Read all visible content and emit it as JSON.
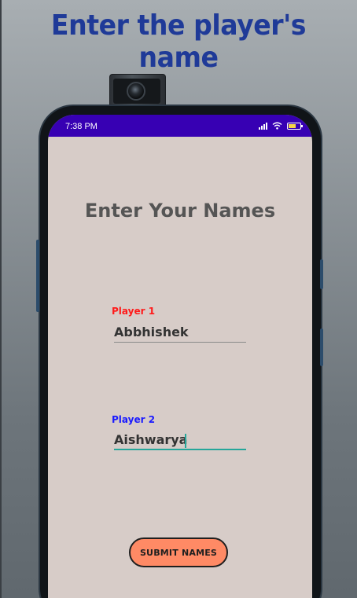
{
  "header": {
    "title": "Enter the player's name"
  },
  "status_bar": {
    "time": "7:38 PM",
    "battery_level": "80"
  },
  "app": {
    "title": "Enter Your Names",
    "player1": {
      "label": "Player 1",
      "value": "Abbhishek"
    },
    "player2": {
      "label": "Player 2",
      "value": "Aishwarya"
    },
    "submit_label": "SUBMIT NAMES"
  },
  "colors": {
    "status_bar": "#3700b3",
    "screen_bg": "#d7ccc8",
    "player1_label": "#ff1a1a",
    "player2_label": "#1a1aff",
    "focus_underline": "#26a69a",
    "button_bg": "#ff8a65",
    "header_title": "#1f3a98"
  },
  "icons": [
    "signal-icon",
    "wifi-icon",
    "battery-icon",
    "camera-icon"
  ]
}
